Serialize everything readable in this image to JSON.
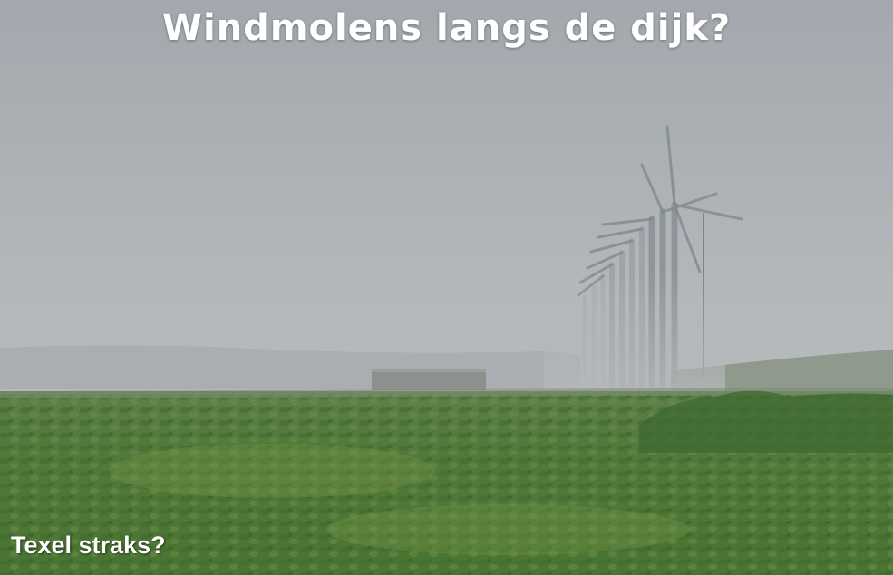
{
  "title": "Windmolens langs de dijk?",
  "caption": "Texel straks?",
  "colors": {
    "sky_top": "#a3a9ae",
    "sky_bottom": "#b5b9bc",
    "field_green": "#4f7a38",
    "text": "#ffffff"
  }
}
